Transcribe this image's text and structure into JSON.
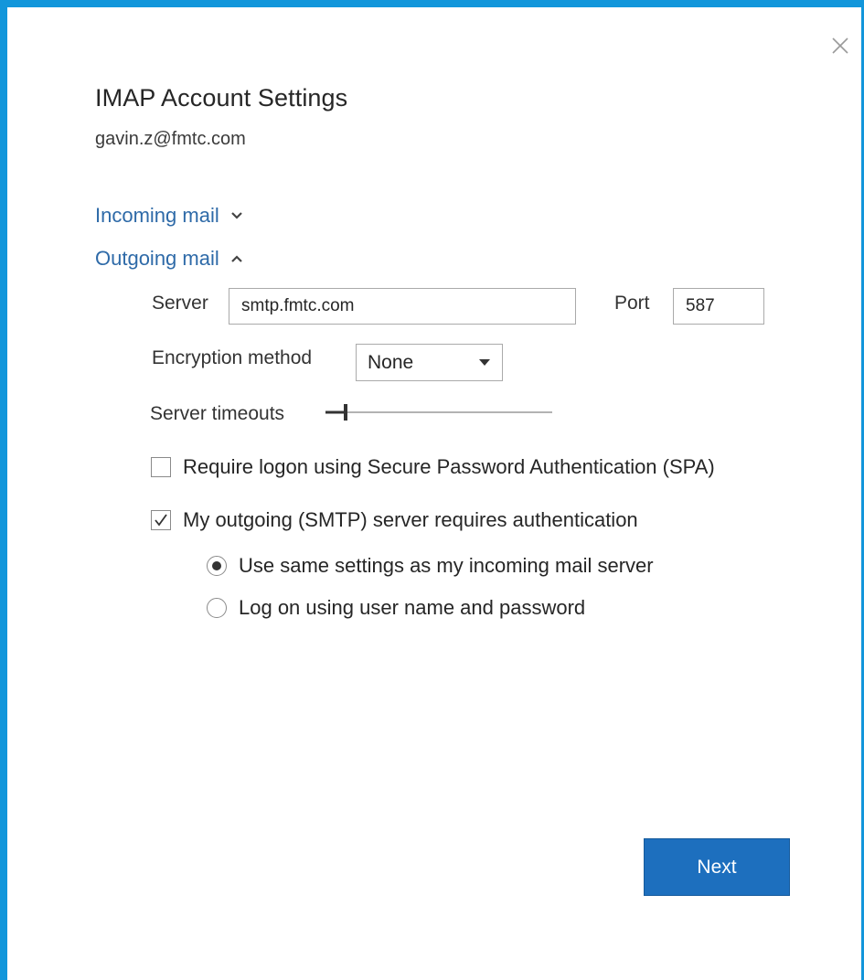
{
  "dialog": {
    "title": "IMAP Account Settings",
    "email": "gavin.z@fmtc.com",
    "close_icon": "close-icon",
    "accent_color": "#1296db"
  },
  "sections": {
    "incoming": {
      "label": "Incoming mail",
      "icon": "chevron-down-icon",
      "expanded": false
    },
    "outgoing": {
      "label": "Outgoing mail",
      "icon": "chevron-up-icon",
      "expanded": true
    }
  },
  "outgoing": {
    "server_label": "Server",
    "server_value": "smtp.fmtc.com",
    "port_label": "Port",
    "port_value": "587",
    "encryption_label": "Encryption method",
    "encryption_value": "None",
    "timeouts_label": "Server timeouts",
    "timeouts_level": 0.08,
    "spa": {
      "label": "Require logon using Secure Password Authentication (SPA)",
      "checked": false
    },
    "smtp_auth": {
      "label": "My outgoing (SMTP) server requires authentication",
      "checked": true
    },
    "auth_options": [
      {
        "label": "Use same settings as my incoming mail server",
        "selected": true
      },
      {
        "label": "Log on using user name and password",
        "selected": false
      }
    ]
  },
  "footer": {
    "next_label": "Next",
    "button_color": "#1d6fbe"
  }
}
